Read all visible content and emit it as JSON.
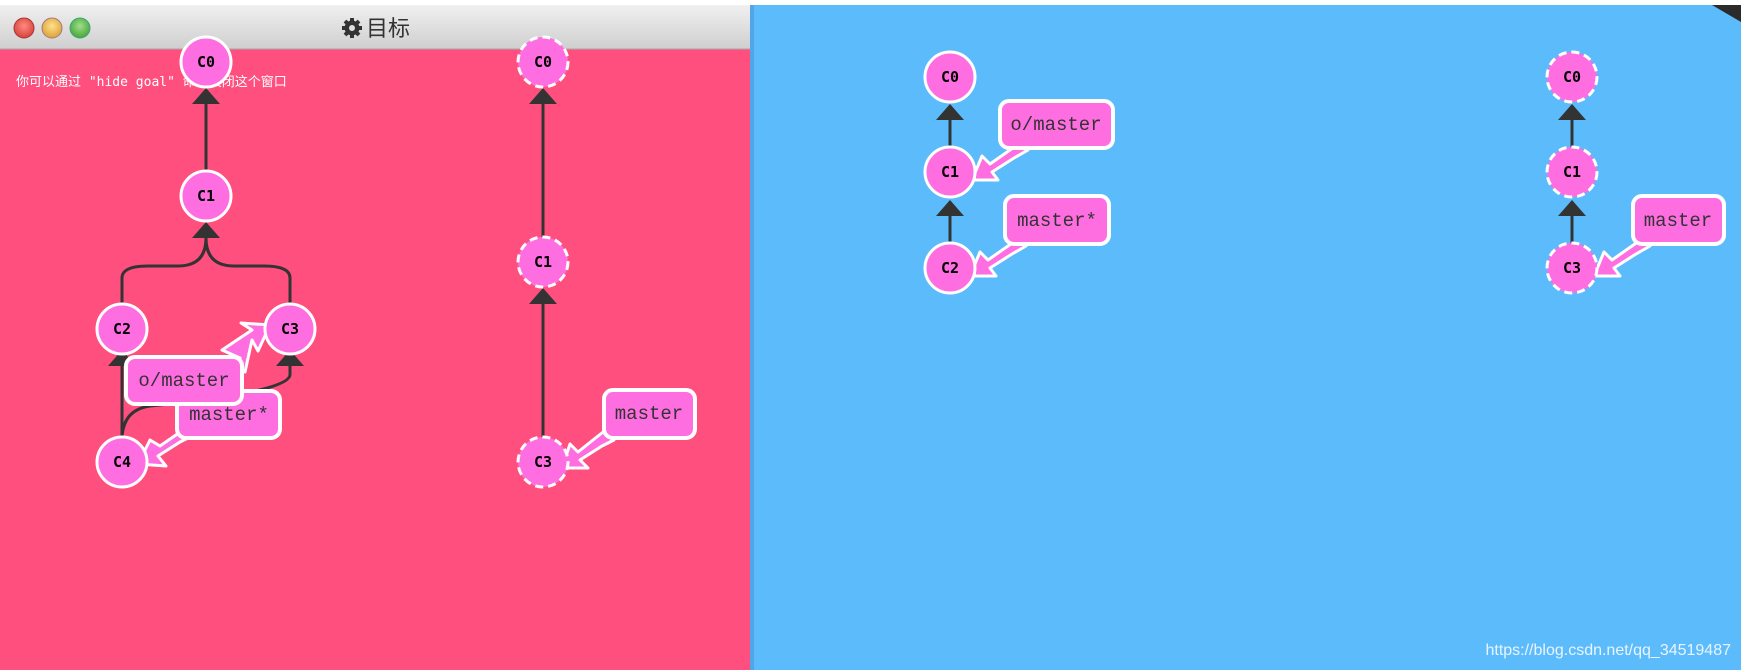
{
  "goal_window": {
    "title": "目标",
    "title_icon": "gear-icon",
    "hint": "你可以通过 \"hide goal\" 命令关闭这个窗口",
    "traffic_lights": [
      "close",
      "minimize",
      "maximize"
    ],
    "colors": {
      "background": "#ff4f7e",
      "titlebar": "#e4e4e4"
    },
    "local_repo": {
      "commits": [
        "C0",
        "C1",
        "C2",
        "C3",
        "C4"
      ],
      "branches": [
        "o/master",
        "master*"
      ]
    },
    "remote_repo": {
      "commits": [
        "C0",
        "C1",
        "C3"
      ],
      "branches": [
        "master"
      ]
    }
  },
  "main_view": {
    "colors": {
      "background": "#5cbcfb"
    },
    "local_repo": {
      "commits": [
        "C0",
        "C1",
        "C2"
      ],
      "branches": [
        "o/master",
        "master*"
      ]
    },
    "remote_repo": {
      "commits": [
        "C0",
        "C1",
        "C3"
      ],
      "branches": [
        "master"
      ]
    },
    "watermark": "https://blog.csdn.net/qq_34519487"
  },
  "colors": {
    "commit_fill": "#ff6ee0",
    "commit_stroke": "#ffffff",
    "edge": "#333333"
  }
}
